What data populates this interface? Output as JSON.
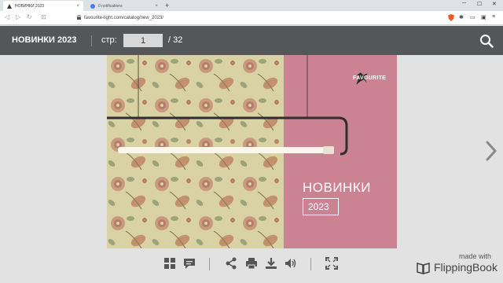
{
  "browser": {
    "active_tab": "НОВИНКИ 2023",
    "inactive_tab": "0 notifications",
    "url": "favourite-light.com/catalog/new_2023/",
    "new_tab": "+"
  },
  "toolbar": {
    "title": "НОВИНКИ 2023",
    "page_label": "стр:",
    "page_value": "1",
    "page_total": "/ 32"
  },
  "cover": {
    "brand": "FAVOURITE",
    "title": "НОВИНКИ",
    "year": "2023"
  },
  "footer": {
    "made_with": "made with",
    "brand": "FlippingBook"
  },
  "colors": {
    "toolbar_bg": "#545658",
    "page_bg": "#e2e2e2",
    "cover_pink": "#cb8394",
    "cover_pattern": "#d9d2a4"
  }
}
